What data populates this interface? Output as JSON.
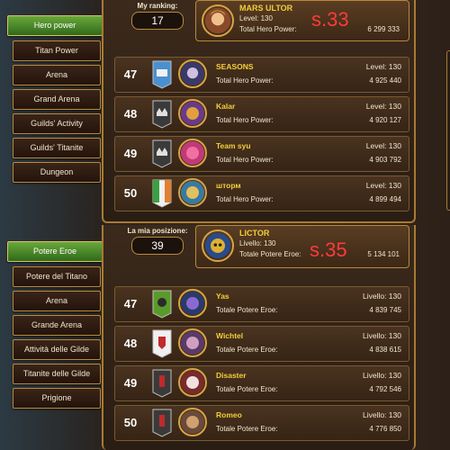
{
  "top": {
    "sidebar": [
      "Hero power",
      "Titan Power",
      "Arena",
      "Grand Arena",
      "Guilds' Activity",
      "Guilds' Titanite",
      "Dungeon"
    ],
    "my_ranking_label": "My ranking:",
    "my_ranking_value": "17",
    "me": {
      "name": "MARS ULTOR",
      "level": "Level: 130",
      "power_label": "Total Hero Power:",
      "power_value": "6 299 333",
      "annotation": "s.33"
    },
    "rows": [
      {
        "rank": "47",
        "name": "SEASONS",
        "level": "Level: 130",
        "power_label": "Total Hero Power:",
        "power_value": "4 925 440"
      },
      {
        "rank": "48",
        "name": "Kalar",
        "level": "Level: 130",
        "power_label": "Total Hero Power:",
        "power_value": "4 920 127"
      },
      {
        "rank": "49",
        "name": "Team syu",
        "level": "Level: 130",
        "power_label": "Total Hero Power:",
        "power_value": "4 903 792"
      },
      {
        "rank": "50",
        "name": "шторм",
        "level": "Level: 130",
        "power_label": "Total Hero Power:",
        "power_value": "4 899 494"
      }
    ]
  },
  "bottom": {
    "sidebar": [
      "Potere Eroe",
      "Potere del Titano",
      "Arena",
      "Grande Arena",
      "Attività delle Gilde",
      "Titanite delle Gilde",
      "Prigione"
    ],
    "my_ranking_label": "La mia posizione:",
    "my_ranking_value": "39",
    "me": {
      "name": "LICTOR",
      "level": "Livello: 130",
      "power_label": "Totale Potere Eroe:",
      "power_value": "5 134 101",
      "annotation": "s.35"
    },
    "rows": [
      {
        "rank": "47",
        "name": "Yas",
        "level": "Livello: 130",
        "power_label": "Totale Potere Eroe:",
        "power_value": "4 839 745"
      },
      {
        "rank": "48",
        "name": "Wichtel",
        "level": "Livello: 130",
        "power_label": "Totale Potere Eroe:",
        "power_value": "4 838 615"
      },
      {
        "rank": "49",
        "name": "Disaster",
        "level": "Livello: 130",
        "power_label": "Totale Potere Eroe:",
        "power_value": "4 792 546"
      },
      {
        "rank": "50",
        "name": "Romeo",
        "level": "Livello: 130",
        "power_label": "Totale Potere Eroe:",
        "power_value": "4 776 850"
      }
    ]
  },
  "colors": {
    "accent": "#6aa73a",
    "gold": "#b98a3a",
    "name": "#f2cf3a",
    "annotation": "#ff3b3b"
  }
}
